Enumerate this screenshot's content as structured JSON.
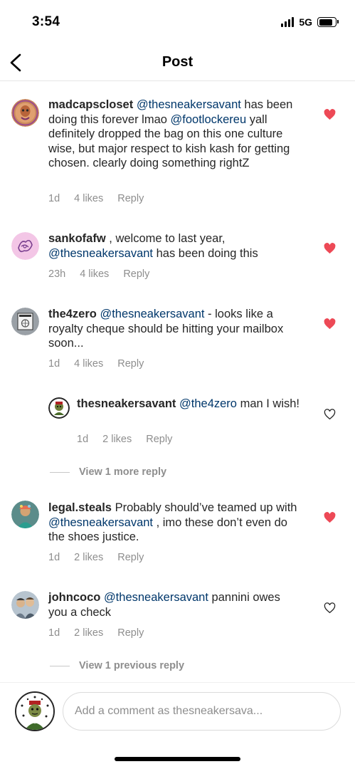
{
  "status": {
    "time": "3:54",
    "network": "5G"
  },
  "header": {
    "title": "Post"
  },
  "comments": [
    {
      "username": "madcapscloset",
      "segments": [
        {
          "t": "@thesneakersavant",
          "m": true
        },
        {
          "t": " has been doing this forever lmao ",
          "m": false
        },
        {
          "t": "@footlockereu",
          "m": true
        },
        {
          "t": " yall definitely dropped the bag on this one culture wise, but major respect to kish kash for getting chosen. clearly doing something rightZ",
          "m": false
        }
      ],
      "time": "1d",
      "likes": "4 likes",
      "reply": "Reply",
      "liked": true
    },
    {
      "username": "sankofafw",
      "segments": [
        {
          "t": " , welcome to last year, ",
          "m": false
        },
        {
          "t": "@thesneakersavant",
          "m": true
        },
        {
          "t": " has been doing this",
          "m": false
        }
      ],
      "time": "23h",
      "likes": "4 likes",
      "reply": "Reply",
      "liked": true
    },
    {
      "username": "the4zero",
      "segments": [
        {
          "t": "@thesneakersavant",
          "m": true
        },
        {
          "t": " - looks like a royalty cheque should be hitting your mailbox soon...",
          "m": false
        }
      ],
      "time": "1d",
      "likes": "4 likes",
      "reply": "Reply",
      "liked": true
    },
    {
      "username": "thesneakersavant",
      "segments": [
        {
          "t": "@the4zero",
          "m": true
        },
        {
          "t": " man I wish!",
          "m": false
        }
      ],
      "time": "1d",
      "likes": "2 likes",
      "reply": "Reply",
      "liked": false
    },
    {
      "username": "legal.steals",
      "segments": [
        {
          "t": " Probably should’ve teamed up with ",
          "m": false
        },
        {
          "t": "@thesneakersavant",
          "m": true
        },
        {
          "t": " , imo these don’t even do the shoes justice.",
          "m": false
        }
      ],
      "time": "1d",
      "likes": "2 likes",
      "reply": "Reply",
      "liked": true
    },
    {
      "username": "johncoco",
      "segments": [
        {
          "t": "@thesneakersavant",
          "m": true
        },
        {
          "t": "  pannini owes you a check",
          "m": false
        }
      ],
      "time": "1d",
      "likes": "2 likes",
      "reply": "Reply",
      "liked": false
    }
  ],
  "view_more_reply": "View 1 more reply",
  "view_previous_reply": "View 1 previous reply",
  "composer": {
    "placeholder": "Add a comment as thesneakersava..."
  },
  "colors": {
    "like_red": "#ed4956",
    "mention_blue": "#00376b",
    "meta_gray": "#8e8e8e"
  }
}
